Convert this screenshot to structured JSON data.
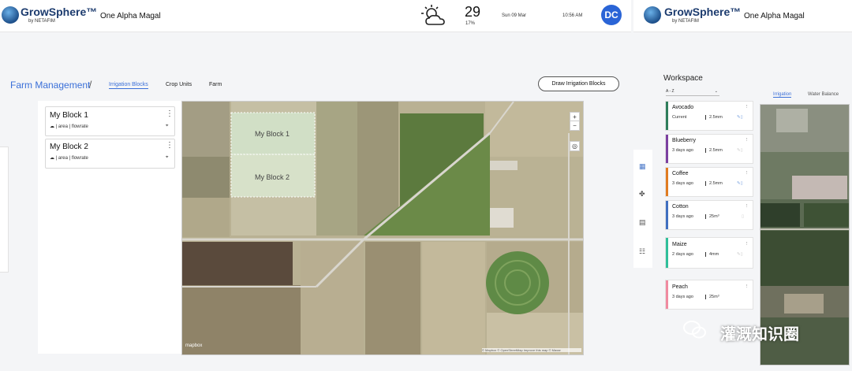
{
  "left_app": {
    "brand": {
      "name": "GrowSphere™",
      "sub": "by NETAFIM"
    },
    "user_name": "One Alpha Magal",
    "weather": {
      "icon": "partly-cloudy-icon",
      "temp": "29",
      "sub": "17%"
    },
    "date": "Sun 09 Mar",
    "time": "10:56 AM",
    "avatar": "DC",
    "breadcrumb": {
      "title": "Farm Management",
      "sep": "/"
    },
    "tabs": [
      {
        "label": "Irrigation Blocks"
      },
      {
        "label": "Crop Units"
      },
      {
        "label": "Farm"
      }
    ],
    "draw_button": "Draw Irrigation Blocks",
    "blocks": [
      {
        "name": "My Block 1",
        "meta1": "area",
        "meta2": "flowrate"
      },
      {
        "name": "My Block 2",
        "meta1": "area",
        "meta2": "flowrate"
      }
    ],
    "map": {
      "labels": [
        "My Block 1",
        "My Block 2"
      ],
      "attribution": "© Mapbox © OpenStreetMap Improve this map © Maxar",
      "brand": "mapbox",
      "zoom_in": "+",
      "zoom_out": "−"
    }
  },
  "right_app": {
    "brand": {
      "name": "GrowSphere™",
      "sub": "by NETAFIM"
    },
    "user_name": "One Alpha Magal",
    "workspace_title": "Workspace",
    "sort": "A - Z",
    "tabs": [
      {
        "label": "Irrigation"
      },
      {
        "label": "Water Balance"
      }
    ],
    "crops": [
      {
        "name": "Avocado",
        "when": "Current",
        "value": "2.5mm",
        "color": "#2e7d5b"
      },
      {
        "name": "Blueberry",
        "when": "3 days ago",
        "value": "2.5mm",
        "color": "#7b3fa0"
      },
      {
        "name": "Coffee",
        "when": "3 days ago",
        "value": "2.5mm",
        "color": "#e07b20"
      },
      {
        "name": "Cotton",
        "when": "3 days ago",
        "value": "25m³",
        "color": "#3f6fc0"
      },
      {
        "name": "Maize",
        "when": "2 days ago",
        "value": "4mm",
        "color": "#2fbf9a"
      },
      {
        "name": "Peach",
        "when": "3 days ago",
        "value": "25m³",
        "color": "#f08aa0"
      }
    ]
  },
  "watermark": "灌溉知识圈"
}
